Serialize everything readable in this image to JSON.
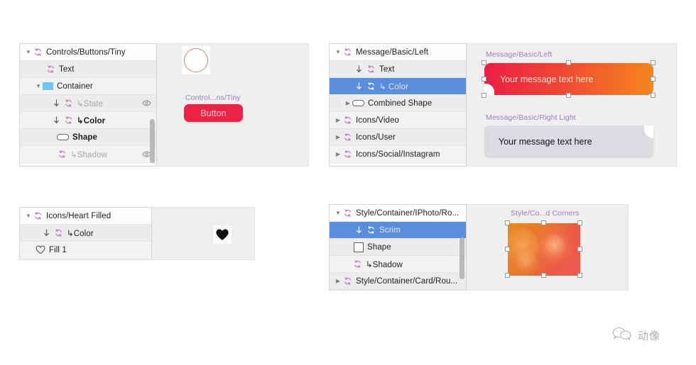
{
  "canvas": {
    "background": "#ffffff",
    "panel_bg": "#efeff0",
    "list_bg": "#f2f2f2",
    "selection_color": "#5a8ddb",
    "symbol_icon_color": "#c07fbd",
    "artboard_label_color": "#9a7fc4"
  },
  "panels": {
    "controls_buttons_tiny": {
      "rows": [
        {
          "label": "Controls/Buttons/Tiny",
          "disclosure": "open",
          "icon": "symbol-icon",
          "indent": 0,
          "state": "normal",
          "eye": false
        },
        {
          "label": "Text",
          "disclosure": "none",
          "icon": "symbol-icon",
          "indent": 1,
          "state": "normal",
          "eye": false
        },
        {
          "label": "Container",
          "disclosure": "open",
          "icon": "blue-swatch",
          "indent": 1,
          "state": "normal",
          "eye": false
        },
        {
          "label": "↳State",
          "disclosure": "none",
          "icon": "symbol-icon",
          "indent": 2,
          "state": "dim",
          "eye": true,
          "override": true
        },
        {
          "label": "↳Color",
          "disclosure": "none",
          "icon": "symbol-icon",
          "indent": 2,
          "state": "bold",
          "eye": false,
          "override": true
        },
        {
          "label": "Shape",
          "disclosure": "none",
          "icon": "shape-pill",
          "indent": 2,
          "state": "bold",
          "eye": false
        },
        {
          "label": "↳Shadow",
          "disclosure": "none",
          "icon": "symbol-icon",
          "indent": 2,
          "state": "dim",
          "eye": true
        }
      ],
      "scroll_thumb": {
        "top_pct": 62,
        "height_pct": 38
      }
    },
    "message_basic_left": {
      "rows": [
        {
          "label": "Message/Basic/Left",
          "disclosure": "open",
          "icon": "symbol-icon",
          "indent": 0,
          "state": "normal",
          "eye": false
        },
        {
          "label": "Text",
          "disclosure": "none",
          "icon": "symbol-icon",
          "indent": 2,
          "state": "normal",
          "eye": false,
          "override": true
        },
        {
          "label": "↳ Color",
          "disclosure": "none",
          "icon": "symbol-icon",
          "indent": 2,
          "state": "selected",
          "eye": false,
          "override": true
        },
        {
          "label": "Combined Shape",
          "disclosure": "closed",
          "icon": "shape-pill",
          "indent": 1,
          "state": "normal",
          "eye": false
        },
        {
          "label": "Icons/Video",
          "disclosure": "closed",
          "icon": "symbol-icon",
          "indent": 0,
          "state": "normal",
          "eye": false
        },
        {
          "label": "Icons/User",
          "disclosure": "closed",
          "icon": "symbol-icon",
          "indent": 0,
          "state": "normal",
          "eye": false
        },
        {
          "label": "Icons/Social/Instagram",
          "disclosure": "closed",
          "icon": "symbol-icon",
          "indent": 0,
          "state": "normal",
          "eye": false
        }
      ]
    },
    "icons_heart_filled": {
      "rows": [
        {
          "label": "Icons/Heart Filled",
          "disclosure": "open",
          "icon": "symbol-icon",
          "indent": 0,
          "state": "normal",
          "eye": false
        },
        {
          "label": "↳Color",
          "disclosure": "none",
          "icon": "symbol-icon",
          "indent": 2,
          "state": "normal",
          "eye": false,
          "override": true
        },
        {
          "label": "Fill 1",
          "disclosure": "none",
          "icon": "heart-icon",
          "indent": 1,
          "state": "normal",
          "eye": false
        }
      ]
    },
    "style_container": {
      "rows": [
        {
          "label": "Style/Container/IPhoto/Ro...",
          "disclosure": "open",
          "icon": "symbol-icon",
          "indent": 0,
          "state": "normal",
          "eye": false
        },
        {
          "label": "Scrim",
          "disclosure": "none",
          "icon": "symbol-icon",
          "indent": 2,
          "state": "selected",
          "eye": false,
          "override": true
        },
        {
          "label": "Shape",
          "disclosure": "none",
          "icon": "shape-rect",
          "indent": 1,
          "state": "normal",
          "eye": false
        },
        {
          "label": "↳Shadow",
          "disclosure": "none",
          "icon": "symbol-icon",
          "indent": 1,
          "state": "normal",
          "eye": false
        },
        {
          "label": "Style/Container/Card/Rou...",
          "disclosure": "closed",
          "icon": "symbol-icon",
          "indent": 0,
          "state": "normal",
          "eye": false
        }
      ],
      "scroll_thumb": {
        "top_pct": 40,
        "height_pct": 50
      }
    }
  },
  "artwork": {
    "button_preview": {
      "artboard_label": "Control...ns/Tiny",
      "button_label": "Button",
      "button_color": "#ed2247",
      "button_text_color": "#f5c8cf",
      "circle_stroke": "#c08a6e"
    },
    "messages": {
      "left": {
        "artboard_label": "Message/Basic/Left",
        "text": "Your message text here",
        "gradient_start": "#ec1d45",
        "gradient_end": "#f5851f",
        "text_color": "#fbe0d2"
      },
      "right_light": {
        "artboard_label": "Message/Basic/Right Light",
        "text": "Your message text here",
        "fill": "#dcdce0",
        "text_color": "#111113"
      }
    },
    "heart_preview": {
      "icon": "heart-filled-icon",
      "fill": "#101010"
    },
    "photo_preview": {
      "artboard_label": "Style/Co...d Corners"
    }
  },
  "watermark": {
    "icon": "wechat-icon",
    "text": "动像"
  }
}
